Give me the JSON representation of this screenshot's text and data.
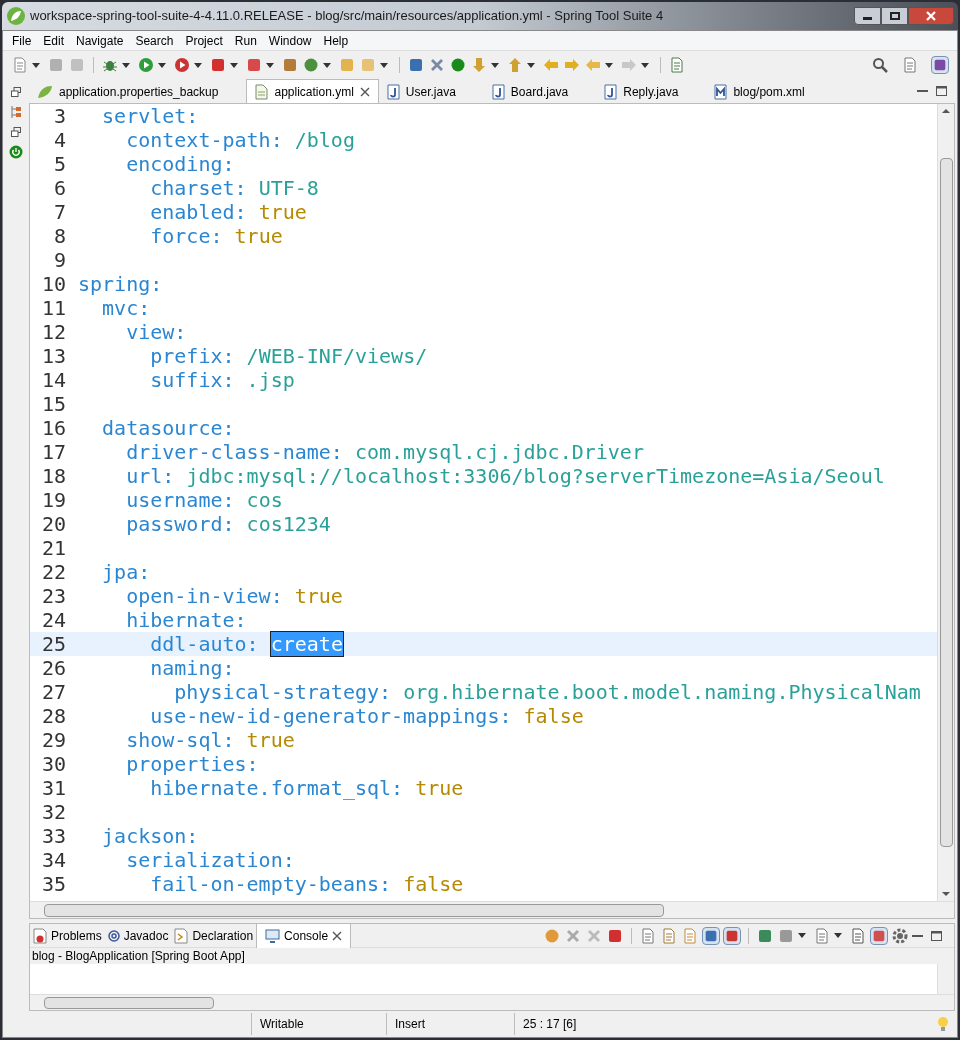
{
  "window": {
    "title": "workspace-spring-tool-suite-4-4.11.0.RELEASE - blog/src/main/resources/application.yml - Spring Tool Suite 4"
  },
  "menu": [
    "File",
    "Edit",
    "Navigate",
    "Search",
    "Project",
    "Run",
    "Window",
    "Help"
  ],
  "editor_tabs": [
    {
      "label": "application.properties_backup",
      "selected": false,
      "kind": "leaf"
    },
    {
      "label": "application.yml",
      "selected": true,
      "kind": "file"
    },
    {
      "label": "User.java",
      "selected": false,
      "kind": "java"
    },
    {
      "label": "Board.java",
      "selected": false,
      "kind": "java"
    },
    {
      "label": "Reply.java",
      "selected": false,
      "kind": "java"
    },
    {
      "label": "blog/pom.xml",
      "selected": false,
      "kind": "maven"
    }
  ],
  "code_lines": [
    {
      "number": "3",
      "key": "  servlet:"
    },
    {
      "number": "4",
      "key": "    context-path:",
      "value": "/blog",
      "kind": "string"
    },
    {
      "number": "5",
      "key": "    encoding:"
    },
    {
      "number": "6",
      "key": "      charset:",
      "value": "UTF-8",
      "kind": "string"
    },
    {
      "number": "7",
      "key": "      enabled:",
      "value": "true",
      "kind": "bool"
    },
    {
      "number": "8",
      "key": "      force:",
      "value": "true",
      "kind": "bool"
    },
    {
      "number": "9"
    },
    {
      "number": "10",
      "key": "spring:"
    },
    {
      "number": "11",
      "key": "  mvc:"
    },
    {
      "number": "12",
      "key": "    view:"
    },
    {
      "number": "13",
      "key": "      prefix:",
      "value": "/WEB-INF/views/",
      "kind": "string"
    },
    {
      "number": "14",
      "key": "      suffix:",
      "value": ".jsp",
      "kind": "string"
    },
    {
      "number": "15"
    },
    {
      "number": "16",
      "key": "  datasource:"
    },
    {
      "number": "17",
      "key": "    driver-class-name:",
      "value": "com.mysql.cj.jdbc.Driver",
      "kind": "string"
    },
    {
      "number": "18",
      "key": "    url:",
      "value": "jdbc:mysql://localhost:3306/blog?serverTimezone=Asia/Seoul",
      "kind": "string"
    },
    {
      "number": "19",
      "key": "    username:",
      "value": "cos",
      "kind": "string"
    },
    {
      "number": "20",
      "key": "    password:",
      "value": "cos1234",
      "kind": "string"
    },
    {
      "number": "21"
    },
    {
      "number": "22",
      "key": "  jpa:"
    },
    {
      "number": "23",
      "key": "    open-in-view:",
      "value": "true",
      "kind": "bool"
    },
    {
      "number": "24",
      "key": "    hibernate:"
    },
    {
      "number": "25",
      "key": "      ddl-auto:",
      "value": "create",
      "current": true,
      "selected": true
    },
    {
      "number": "26",
      "key": "      naming:"
    },
    {
      "number": "27",
      "key": "        physical-strategy:",
      "value": "org.hibernate.boot.model.naming.PhysicalNam",
      "kind": "string"
    },
    {
      "number": "28",
      "key": "      use-new-id-generator-mappings:",
      "value": "false",
      "kind": "bool"
    },
    {
      "number": "29",
      "key": "    show-sql:",
      "value": "true",
      "kind": "bool"
    },
    {
      "number": "30",
      "key": "    properties:"
    },
    {
      "number": "31",
      "key": "      hibernate.format_sql:",
      "value": "true",
      "kind": "bool"
    },
    {
      "number": "32"
    },
    {
      "number": "33",
      "key": "  jackson:"
    },
    {
      "number": "34",
      "key": "    serialization:"
    },
    {
      "number": "35",
      "key": "      fail-on-empty-beans:",
      "value": "false",
      "kind": "bool"
    }
  ],
  "panel_tabs": [
    {
      "label": "Problems",
      "selected": false,
      "kind": "problems"
    },
    {
      "label": "Javadoc",
      "selected": false,
      "kind": "javadoc"
    },
    {
      "label": "Declaration",
      "selected": false,
      "kind": "declaration"
    },
    {
      "label": "Console",
      "selected": true,
      "kind": "console"
    }
  ],
  "console": {
    "launch": "blog - BlogApplication [Spring Boot App]"
  },
  "status_bar": [
    "Writable",
    "Insert",
    "25 : 17 [6]"
  ]
}
